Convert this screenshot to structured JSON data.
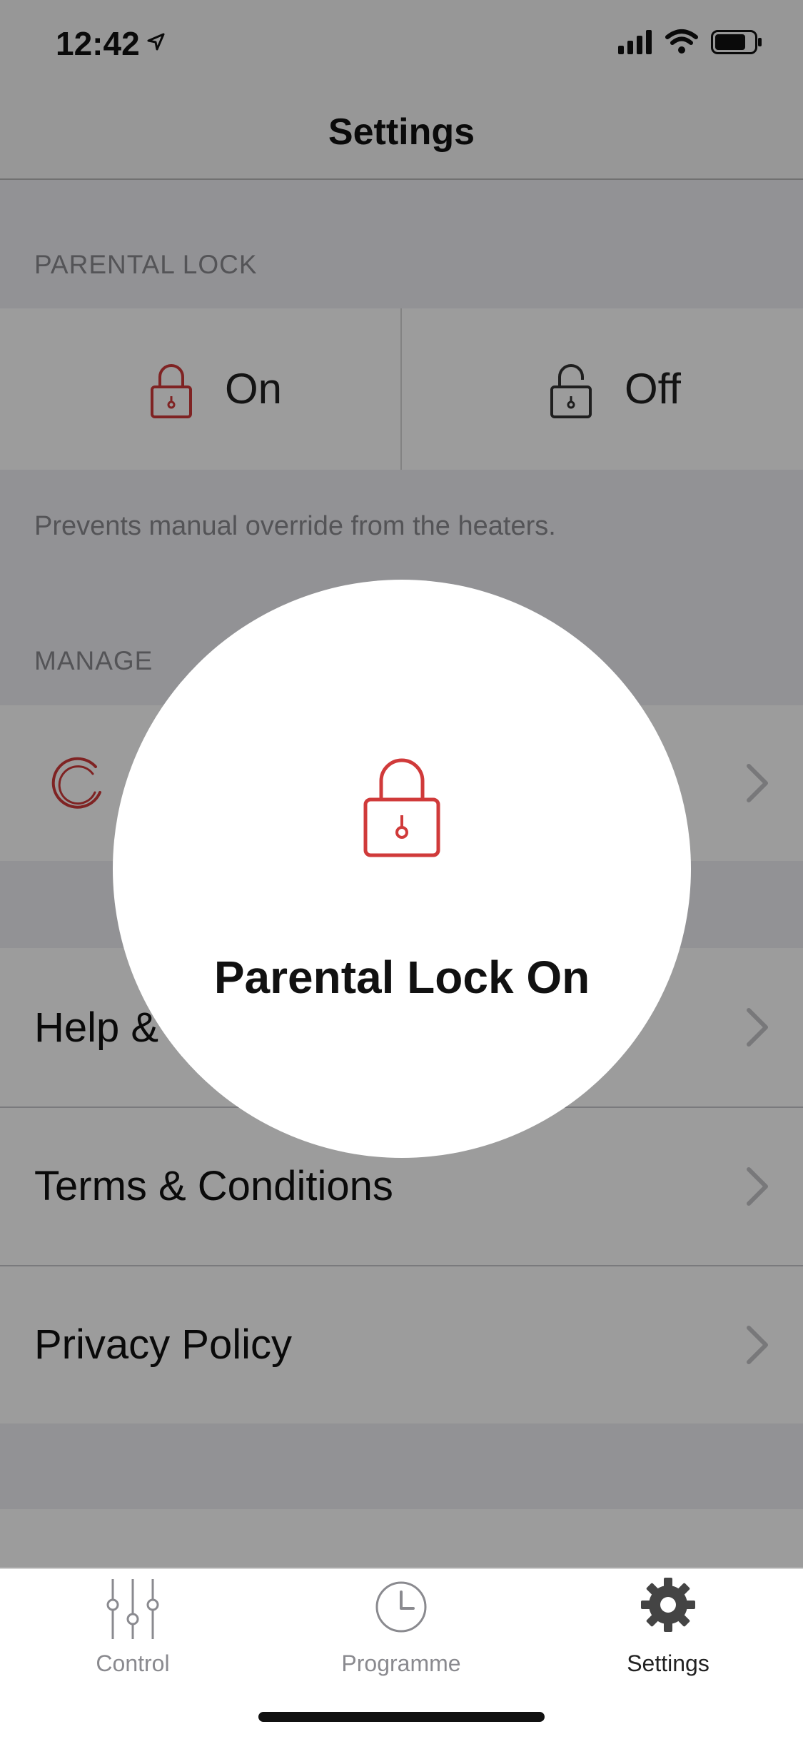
{
  "status_bar": {
    "time": "12:42"
  },
  "nav": {
    "title": "Settings"
  },
  "parental_lock": {
    "section_label": "PARENTAL LOCK",
    "on_label": "On",
    "off_label": "Off",
    "description": "Prevents manual override from the heaters."
  },
  "manage": {
    "section_label": "MANAGE"
  },
  "rows": {
    "help_label": "Help &",
    "terms_label": "Terms & Conditions",
    "privacy_label": "Privacy Policy"
  },
  "tab_bar": {
    "control_label": "Control",
    "programme_label": "Programme",
    "settings_label": "Settings",
    "active_tab": "Settings"
  },
  "toast": {
    "message": "Parental Lock On"
  },
  "colors": {
    "accent_red": "#d03a3a",
    "active_tab": "#222222",
    "inactive_tab": "#8a8a8f"
  }
}
